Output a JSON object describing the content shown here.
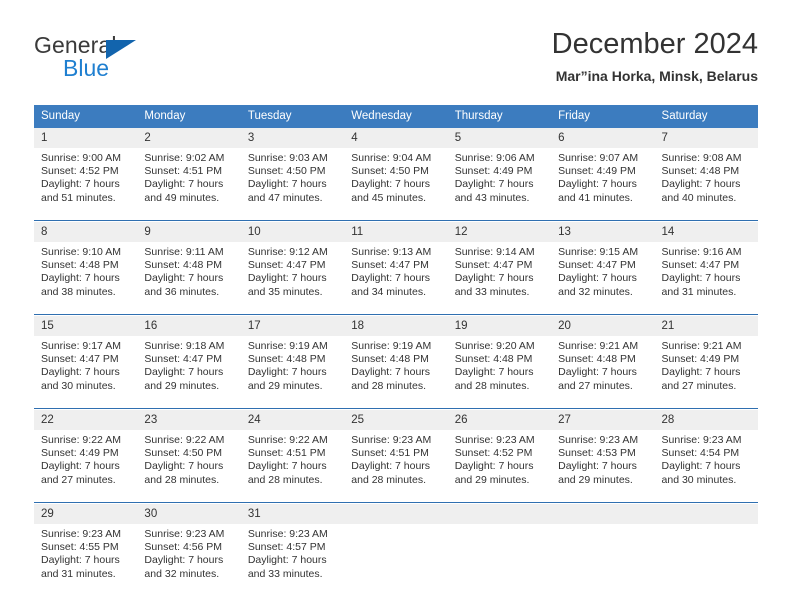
{
  "brand": {
    "name_part1": "General",
    "name_part2": "Blue",
    "logo_icon": "triangle-icon",
    "color_primary": "#1264ad",
    "color_secondary": "#1f7fd0"
  },
  "header": {
    "title": "December 2024",
    "subtitle": "Mar”ina Horka, Minsk, Belarus"
  },
  "calendar": {
    "header_bg": "#3c7cbf",
    "daynum_bg": "#efefef",
    "week_separator_color": "#2f6fb0",
    "weekdays": [
      "Sunday",
      "Monday",
      "Tuesday",
      "Wednesday",
      "Thursday",
      "Friday",
      "Saturday"
    ],
    "weeks": [
      {
        "days": [
          {
            "num": "1",
            "sunrise": "Sunrise: 9:00 AM",
            "sunset": "Sunset: 4:52 PM",
            "daylight_1": "Daylight: 7 hours",
            "daylight_2": "and 51 minutes."
          },
          {
            "num": "2",
            "sunrise": "Sunrise: 9:02 AM",
            "sunset": "Sunset: 4:51 PM",
            "daylight_1": "Daylight: 7 hours",
            "daylight_2": "and 49 minutes."
          },
          {
            "num": "3",
            "sunrise": "Sunrise: 9:03 AM",
            "sunset": "Sunset: 4:50 PM",
            "daylight_1": "Daylight: 7 hours",
            "daylight_2": "and 47 minutes."
          },
          {
            "num": "4",
            "sunrise": "Sunrise: 9:04 AM",
            "sunset": "Sunset: 4:50 PM",
            "daylight_1": "Daylight: 7 hours",
            "daylight_2": "and 45 minutes."
          },
          {
            "num": "5",
            "sunrise": "Sunrise: 9:06 AM",
            "sunset": "Sunset: 4:49 PM",
            "daylight_1": "Daylight: 7 hours",
            "daylight_2": "and 43 minutes."
          },
          {
            "num": "6",
            "sunrise": "Sunrise: 9:07 AM",
            "sunset": "Sunset: 4:49 PM",
            "daylight_1": "Daylight: 7 hours",
            "daylight_2": "and 41 minutes."
          },
          {
            "num": "7",
            "sunrise": "Sunrise: 9:08 AM",
            "sunset": "Sunset: 4:48 PM",
            "daylight_1": "Daylight: 7 hours",
            "daylight_2": "and 40 minutes."
          }
        ]
      },
      {
        "days": [
          {
            "num": "8",
            "sunrise": "Sunrise: 9:10 AM",
            "sunset": "Sunset: 4:48 PM",
            "daylight_1": "Daylight: 7 hours",
            "daylight_2": "and 38 minutes."
          },
          {
            "num": "9",
            "sunrise": "Sunrise: 9:11 AM",
            "sunset": "Sunset: 4:48 PM",
            "daylight_1": "Daylight: 7 hours",
            "daylight_2": "and 36 minutes."
          },
          {
            "num": "10",
            "sunrise": "Sunrise: 9:12 AM",
            "sunset": "Sunset: 4:47 PM",
            "daylight_1": "Daylight: 7 hours",
            "daylight_2": "and 35 minutes."
          },
          {
            "num": "11",
            "sunrise": "Sunrise: 9:13 AM",
            "sunset": "Sunset: 4:47 PM",
            "daylight_1": "Daylight: 7 hours",
            "daylight_2": "and 34 minutes."
          },
          {
            "num": "12",
            "sunrise": "Sunrise: 9:14 AM",
            "sunset": "Sunset: 4:47 PM",
            "daylight_1": "Daylight: 7 hours",
            "daylight_2": "and 33 minutes."
          },
          {
            "num": "13",
            "sunrise": "Sunrise: 9:15 AM",
            "sunset": "Sunset: 4:47 PM",
            "daylight_1": "Daylight: 7 hours",
            "daylight_2": "and 32 minutes."
          },
          {
            "num": "14",
            "sunrise": "Sunrise: 9:16 AM",
            "sunset": "Sunset: 4:47 PM",
            "daylight_1": "Daylight: 7 hours",
            "daylight_2": "and 31 minutes."
          }
        ]
      },
      {
        "days": [
          {
            "num": "15",
            "sunrise": "Sunrise: 9:17 AM",
            "sunset": "Sunset: 4:47 PM",
            "daylight_1": "Daylight: 7 hours",
            "daylight_2": "and 30 minutes."
          },
          {
            "num": "16",
            "sunrise": "Sunrise: 9:18 AM",
            "sunset": "Sunset: 4:47 PM",
            "daylight_1": "Daylight: 7 hours",
            "daylight_2": "and 29 minutes."
          },
          {
            "num": "17",
            "sunrise": "Sunrise: 9:19 AM",
            "sunset": "Sunset: 4:48 PM",
            "daylight_1": "Daylight: 7 hours",
            "daylight_2": "and 29 minutes."
          },
          {
            "num": "18",
            "sunrise": "Sunrise: 9:19 AM",
            "sunset": "Sunset: 4:48 PM",
            "daylight_1": "Daylight: 7 hours",
            "daylight_2": "and 28 minutes."
          },
          {
            "num": "19",
            "sunrise": "Sunrise: 9:20 AM",
            "sunset": "Sunset: 4:48 PM",
            "daylight_1": "Daylight: 7 hours",
            "daylight_2": "and 28 minutes."
          },
          {
            "num": "20",
            "sunrise": "Sunrise: 9:21 AM",
            "sunset": "Sunset: 4:48 PM",
            "daylight_1": "Daylight: 7 hours",
            "daylight_2": "and 27 minutes."
          },
          {
            "num": "21",
            "sunrise": "Sunrise: 9:21 AM",
            "sunset": "Sunset: 4:49 PM",
            "daylight_1": "Daylight: 7 hours",
            "daylight_2": "and 27 minutes."
          }
        ]
      },
      {
        "days": [
          {
            "num": "22",
            "sunrise": "Sunrise: 9:22 AM",
            "sunset": "Sunset: 4:49 PM",
            "daylight_1": "Daylight: 7 hours",
            "daylight_2": "and 27 minutes."
          },
          {
            "num": "23",
            "sunrise": "Sunrise: 9:22 AM",
            "sunset": "Sunset: 4:50 PM",
            "daylight_1": "Daylight: 7 hours",
            "daylight_2": "and 28 minutes."
          },
          {
            "num": "24",
            "sunrise": "Sunrise: 9:22 AM",
            "sunset": "Sunset: 4:51 PM",
            "daylight_1": "Daylight: 7 hours",
            "daylight_2": "and 28 minutes."
          },
          {
            "num": "25",
            "sunrise": "Sunrise: 9:23 AM",
            "sunset": "Sunset: 4:51 PM",
            "daylight_1": "Daylight: 7 hours",
            "daylight_2": "and 28 minutes."
          },
          {
            "num": "26",
            "sunrise": "Sunrise: 9:23 AM",
            "sunset": "Sunset: 4:52 PM",
            "daylight_1": "Daylight: 7 hours",
            "daylight_2": "and 29 minutes."
          },
          {
            "num": "27",
            "sunrise": "Sunrise: 9:23 AM",
            "sunset": "Sunset: 4:53 PM",
            "daylight_1": "Daylight: 7 hours",
            "daylight_2": "and 29 minutes."
          },
          {
            "num": "28",
            "sunrise": "Sunrise: 9:23 AM",
            "sunset": "Sunset: 4:54 PM",
            "daylight_1": "Daylight: 7 hours",
            "daylight_2": "and 30 minutes."
          }
        ]
      },
      {
        "days": [
          {
            "num": "29",
            "sunrise": "Sunrise: 9:23 AM",
            "sunset": "Sunset: 4:55 PM",
            "daylight_1": "Daylight: 7 hours",
            "daylight_2": "and 31 minutes."
          },
          {
            "num": "30",
            "sunrise": "Sunrise: 9:23 AM",
            "sunset": "Sunset: 4:56 PM",
            "daylight_1": "Daylight: 7 hours",
            "daylight_2": "and 32 minutes."
          },
          {
            "num": "31",
            "sunrise": "Sunrise: 9:23 AM",
            "sunset": "Sunset: 4:57 PM",
            "daylight_1": "Daylight: 7 hours",
            "daylight_2": "and 33 minutes."
          },
          {
            "num": "",
            "sunrise": "",
            "sunset": "",
            "daylight_1": "",
            "daylight_2": ""
          },
          {
            "num": "",
            "sunrise": "",
            "sunset": "",
            "daylight_1": "",
            "daylight_2": ""
          },
          {
            "num": "",
            "sunrise": "",
            "sunset": "",
            "daylight_1": "",
            "daylight_2": ""
          },
          {
            "num": "",
            "sunrise": "",
            "sunset": "",
            "daylight_1": "",
            "daylight_2": ""
          }
        ]
      }
    ]
  }
}
